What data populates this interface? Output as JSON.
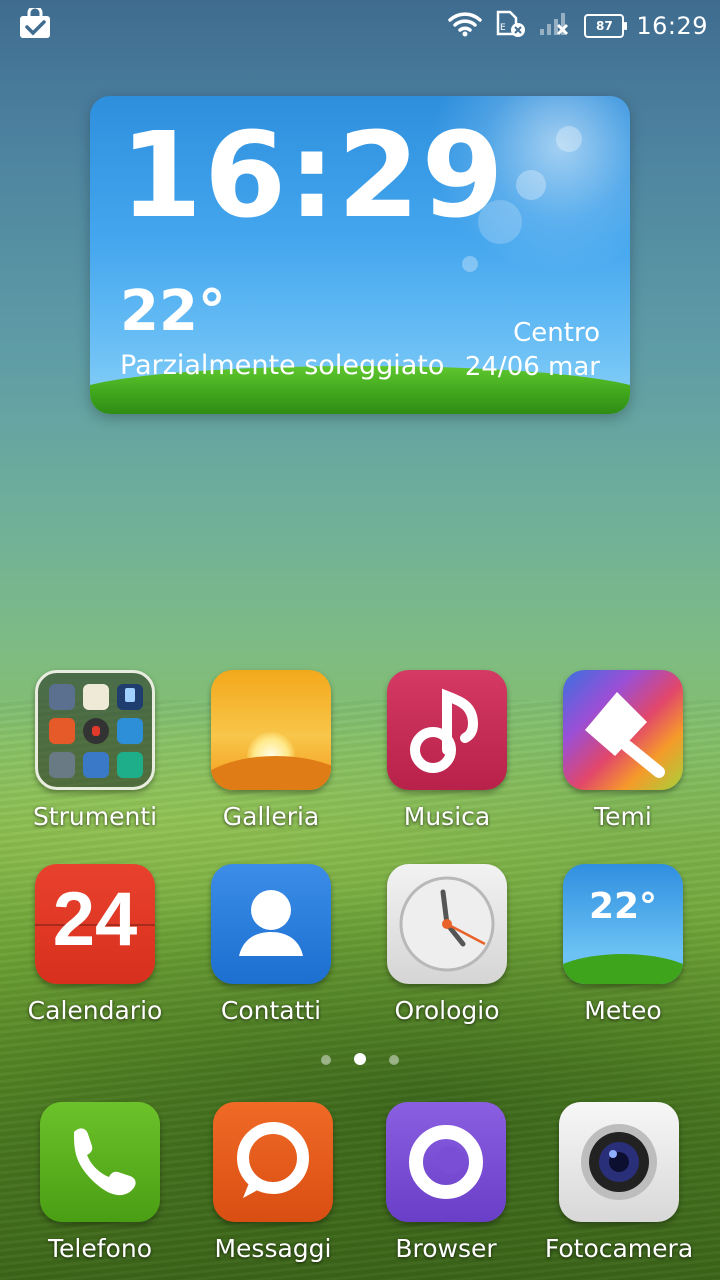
{
  "status_bar": {
    "time": "16:29",
    "battery": "87",
    "icons": [
      "bag-check-icon",
      "wifi-icon",
      "sim-error-icon",
      "signal-no-service-icon",
      "battery-icon"
    ]
  },
  "widget": {
    "time": "16:29",
    "temperature": "22°",
    "condition": "Parzialmente soleggiato",
    "city": "Centro",
    "date": "24/06 mar"
  },
  "apps_row1": [
    {
      "label": "Strumenti",
      "icon": "folder-icon"
    },
    {
      "label": "Galleria",
      "icon": "sunset-icon"
    },
    {
      "label": "Musica",
      "icon": "music-note-icon"
    },
    {
      "label": "Temi",
      "icon": "paintbrush-icon"
    }
  ],
  "apps_row2": [
    {
      "label": "Calendario",
      "icon": "calendar-icon",
      "day": "24"
    },
    {
      "label": "Contatti",
      "icon": "person-icon"
    },
    {
      "label": "Orologio",
      "icon": "clock-icon"
    },
    {
      "label": "Meteo",
      "icon": "weather-icon",
      "temp": "22°"
    }
  ],
  "dock": [
    {
      "label": "Telefono",
      "icon": "phone-icon"
    },
    {
      "label": "Messaggi",
      "icon": "chat-bubble-icon"
    },
    {
      "label": "Browser",
      "icon": "browser-ring-icon"
    },
    {
      "label": "Fotocamera",
      "icon": "camera-lens-icon"
    }
  ],
  "pager": {
    "pages": 3,
    "current": 2
  }
}
